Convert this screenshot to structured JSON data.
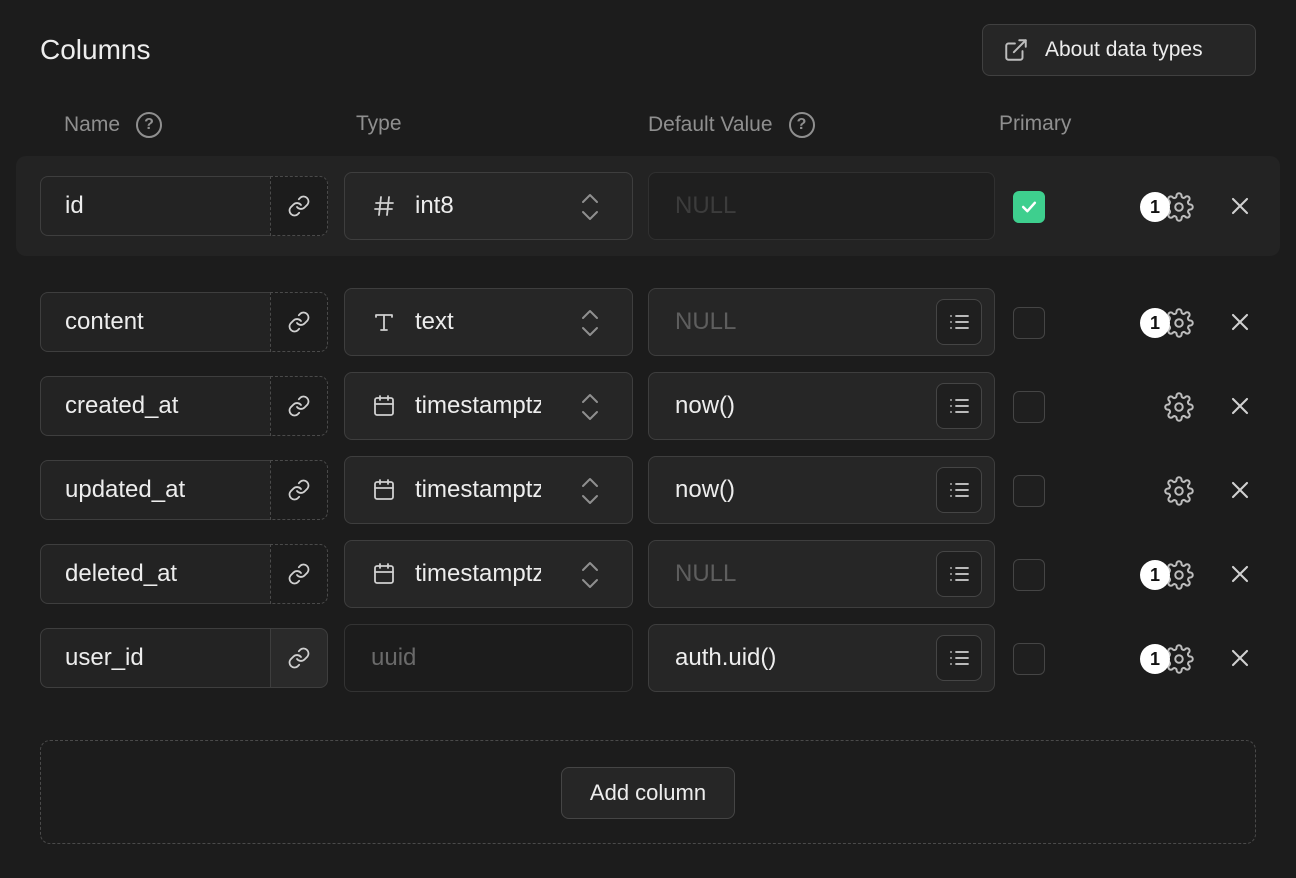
{
  "title": "Columns",
  "about_button": {
    "label": "About data types",
    "icon": "external-link-icon"
  },
  "headers": {
    "name": "Name",
    "type": "Type",
    "default_value": "Default Value",
    "primary": "Primary"
  },
  "rows": [
    {
      "name": "id",
      "type": "int8",
      "type_icon": "hash-icon",
      "default_value": "NULL",
      "default_is_placeholder": true,
      "primary": true,
      "badge": "1",
      "has_type_select": true
    },
    {
      "name": "content",
      "type": "text",
      "type_icon": "text-type-icon",
      "default_value": "NULL",
      "default_is_placeholder": true,
      "primary": false,
      "badge": "1",
      "has_type_select": true
    },
    {
      "name": "created_at",
      "type": "timestamptz",
      "type_icon": "calendar-icon",
      "default_value": "now()",
      "default_is_placeholder": false,
      "primary": false,
      "badge": "",
      "has_type_select": true
    },
    {
      "name": "updated_at",
      "type": "timestamptz",
      "type_icon": "calendar-icon",
      "default_value": "now()",
      "default_is_placeholder": false,
      "primary": false,
      "badge": "",
      "has_type_select": true
    },
    {
      "name": "deleted_at",
      "type": "timestamptz",
      "type_icon": "calendar-icon",
      "default_value": "NULL",
      "default_is_placeholder": true,
      "primary": false,
      "badge": "1",
      "has_type_select": true
    },
    {
      "name": "user_id",
      "type": "uuid",
      "type_icon": "",
      "default_value": "auth.uid()",
      "default_is_placeholder": false,
      "primary": false,
      "badge": "1",
      "has_type_select": false
    }
  ],
  "add_column_label": "Add column",
  "colors": {
    "background": "#1c1c1c",
    "accent": "#3ecf8e",
    "border": "#3e3e3e",
    "muted_text": "#8f8f8f"
  }
}
